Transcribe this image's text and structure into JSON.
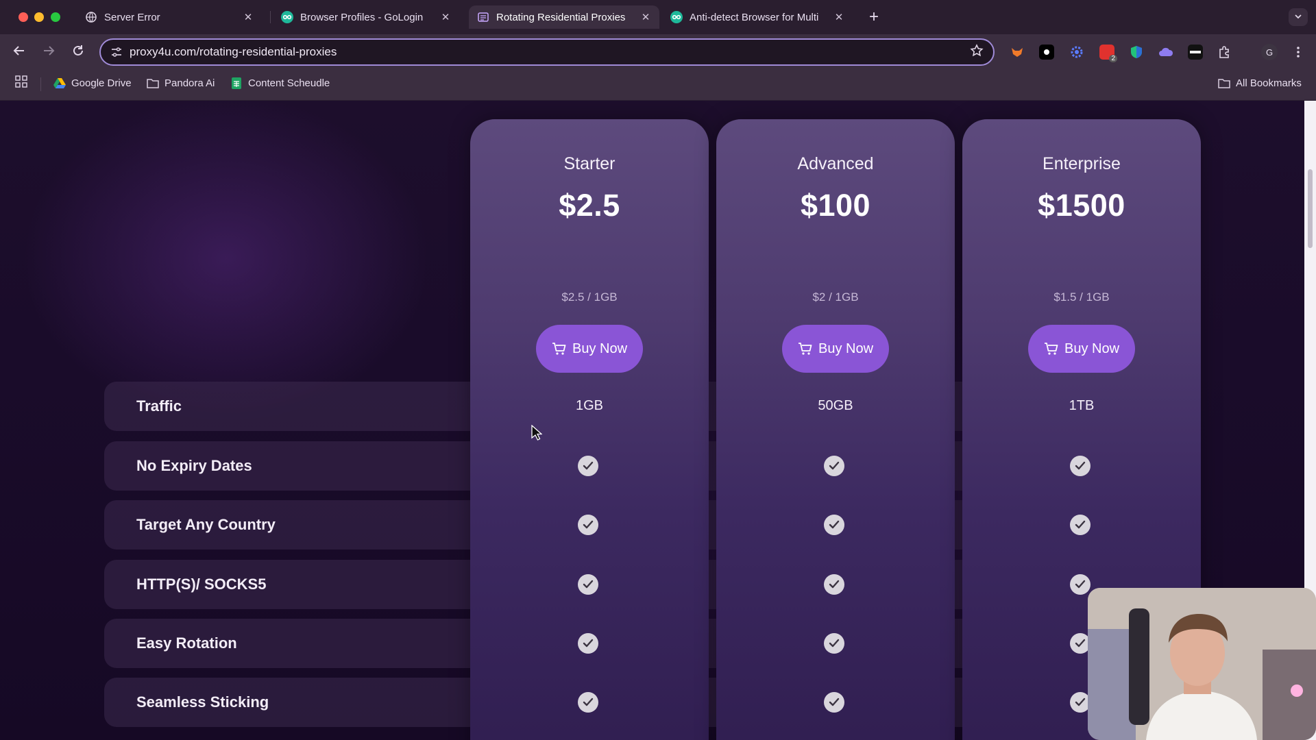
{
  "browser": {
    "tabs": [
      {
        "title": "Server Error",
        "favicon": "globe-icon",
        "active": false
      },
      {
        "title": "Browser Profiles - GoLogin",
        "favicon": "gologin-icon",
        "active": false
      },
      {
        "title": "Rotating Residential Proxies",
        "favicon": "page-icon",
        "active": true
      },
      {
        "title": "Anti-detect Browser for Multi",
        "favicon": "gologin-icon",
        "active": false
      }
    ],
    "tab_close_glyph": "✕",
    "new_tab_glyph": "+",
    "url": "proxy4u.com/rotating-residential-proxies",
    "bookmarks": [
      {
        "label": "Google Drive",
        "icon": "google-drive-icon"
      },
      {
        "label": "Pandora Ai",
        "icon": "folder-icon"
      },
      {
        "label": "Content Scheudle",
        "icon": "sheets-icon"
      }
    ],
    "all_bookmarks_label": "All Bookmarks",
    "profile_initial": "G",
    "extension_badge": "2"
  },
  "pricing": {
    "plans": [
      {
        "name": "Starter",
        "price": "$2.5",
        "unit_price": "$2.5 / 1GB",
        "buy_label": "Buy Now",
        "traffic": "1GB"
      },
      {
        "name": "Advanced",
        "price": "$100",
        "unit_price": "$2 / 1GB",
        "buy_label": "Buy Now",
        "traffic": "50GB"
      },
      {
        "name": "Enterprise",
        "price": "$1500",
        "unit_price": "$1.5 / 1GB",
        "buy_label": "Buy Now",
        "traffic": "1TB"
      }
    ],
    "features": [
      {
        "label": "Traffic"
      },
      {
        "label": "No Expiry Dates",
        "included": [
          true,
          true,
          true
        ]
      },
      {
        "label": "Target Any Country",
        "included": [
          true,
          true,
          true
        ]
      },
      {
        "label": "HTTP(S)/ SOCKS5",
        "included": [
          true,
          true,
          true
        ]
      },
      {
        "label": "Easy Rotation",
        "included": [
          true,
          true,
          true
        ]
      },
      {
        "label": "Seamless Sticking",
        "included": [
          true,
          true,
          true
        ]
      }
    ]
  },
  "colors": {
    "accent_button": "#8a55d6",
    "card_top": "#5d4a7d",
    "page_background": "#1a0c2a"
  }
}
